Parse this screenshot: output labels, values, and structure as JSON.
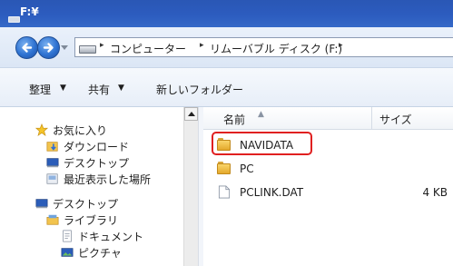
{
  "window": {
    "title": "F:¥"
  },
  "address": {
    "crumbs": [
      "コンピューター",
      "リムーバブル ディスク (F:)"
    ]
  },
  "toolbar": {
    "organize_label": "整理",
    "share_label": "共有",
    "new_folder_label": "新しいフォルダー"
  },
  "nav": {
    "items": [
      {
        "label": "お気に入り",
        "icon": "star-icon"
      },
      {
        "label": "ダウンロード",
        "icon": "download-folder-icon"
      },
      {
        "label": "デスクトップ",
        "icon": "desktop-icon"
      },
      {
        "label": "最近表示した場所",
        "icon": "recent-places-icon"
      },
      {
        "label": "デスクトップ",
        "icon": "desktop-icon"
      },
      {
        "label": "ライブラリ",
        "icon": "library-icon"
      },
      {
        "label": "ドキュメント",
        "icon": "document-icon"
      },
      {
        "label": "ピクチャ",
        "icon": "picture-icon"
      }
    ]
  },
  "files": {
    "columns": {
      "name": "名前",
      "size": "サイズ"
    },
    "rows": [
      {
        "name": "NAVIDATA",
        "size": "",
        "icon": "folder-icon",
        "highlighted": true
      },
      {
        "name": "PC",
        "size": "",
        "icon": "folder-icon"
      },
      {
        "name": "PCLINK.DAT",
        "size": "4 KB",
        "icon": "file-icon"
      }
    ]
  },
  "colors": {
    "title_bar": "#2c5cbf",
    "highlight_border": "#e02020",
    "folder": "#f2c44e"
  }
}
